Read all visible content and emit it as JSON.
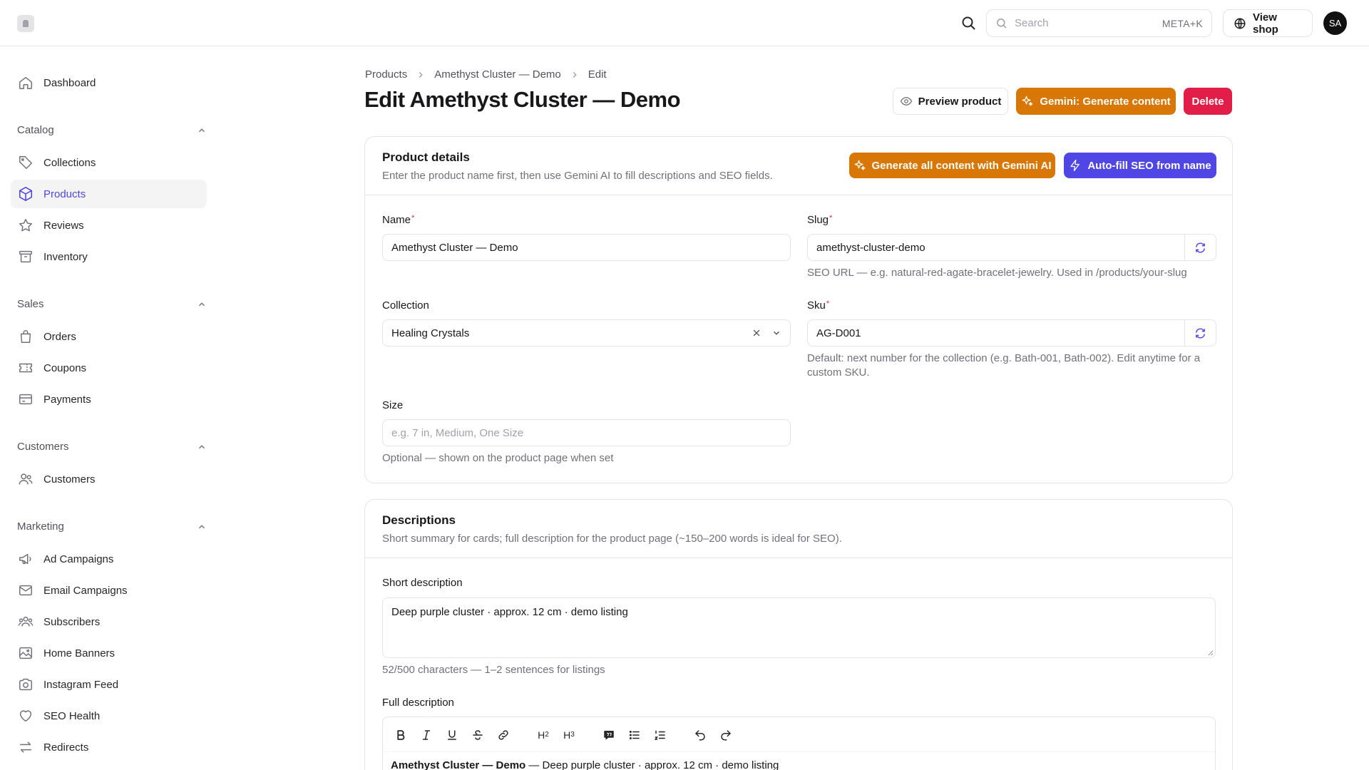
{
  "topbar": {
    "search_placeholder": "Search",
    "search_shortcut": "META+K",
    "view_shop": "View shop",
    "avatar_initials": "SA"
  },
  "sidebar": {
    "dashboard": "Dashboard",
    "groups": {
      "catalog": "Catalog",
      "sales": "Sales",
      "customers": "Customers",
      "marketing": "Marketing"
    },
    "items": {
      "collections": "Collections",
      "products": "Products",
      "reviews": "Reviews",
      "inventory": "Inventory",
      "orders": "Orders",
      "coupons": "Coupons",
      "payments": "Payments",
      "customers": "Customers",
      "ad_campaigns": "Ad Campaigns",
      "email_campaigns": "Email Campaigns",
      "subscribers": "Subscribers",
      "home_banners": "Home Banners",
      "instagram_feed": "Instagram Feed",
      "seo_health": "SEO Health",
      "redirects": "Redirects"
    },
    "active": "products"
  },
  "breadcrumb": [
    "Products",
    "Amethyst Cluster — Demo",
    "Edit"
  ],
  "page": {
    "title": "Edit Amethyst Cluster — Demo",
    "preview_button": "Preview product",
    "gemini_button": "Gemini: Generate content",
    "delete_button": "Delete"
  },
  "product_details": {
    "title": "Product details",
    "subtitle": "Enter the product name first, then use Gemini AI to fill descriptions and SEO fields.",
    "generate_all_button": "Generate all content with Gemini AI",
    "autofill_seo_button": "Auto-fill SEO from name",
    "name_label": "Name",
    "name_value": "Amethyst Cluster — Demo",
    "slug_label": "Slug",
    "slug_value": "amethyst-cluster-demo",
    "slug_help": "SEO URL — e.g. natural-red-agate-bracelet-jewelry. Used in /products/your-slug",
    "collection_label": "Collection",
    "collection_value": "Healing Crystals",
    "sku_label": "Sku",
    "sku_value": "AG-D001",
    "sku_help_1": "Default: next number for the collection (e.g. Bath-001, Bath-002). Edit anytime for a",
    "sku_help_2": "custom SKU.",
    "size_label": "Size",
    "size_placeholder": "e.g. 7 in, Medium, One Size",
    "size_help": "Optional — shown on the product page when set"
  },
  "descriptions": {
    "title": "Descriptions",
    "subtitle": "Short summary for cards; full description for the product page (~150–200 words is ideal for SEO).",
    "short_label": "Short description",
    "short_value": "Deep purple cluster · approx. 12 cm · demo listing",
    "short_help": "52/500 characters — 1–2 sentences for listings",
    "full_label": "Full description",
    "full_bold": "Amethyst Cluster — Demo",
    "full_rest": " — Deep purple cluster · approx. 12 cm · demo listing"
  },
  "colors": {
    "accent": "#4f46e5",
    "gemini_orange": "#d97706",
    "delete_red": "#e11d48"
  }
}
